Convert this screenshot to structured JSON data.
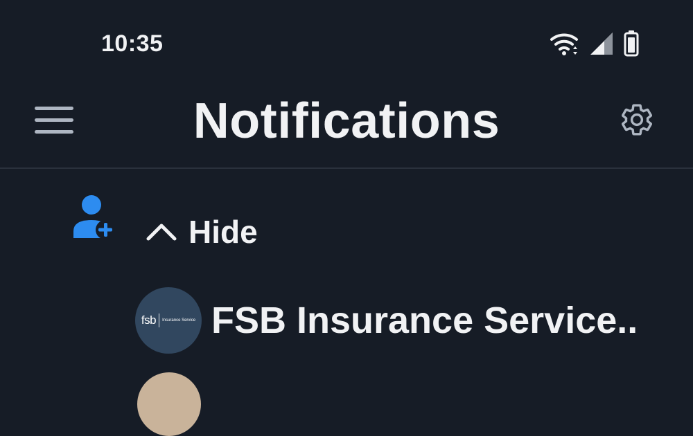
{
  "status_bar": {
    "time": "10:35",
    "icons": [
      "wifi-icon",
      "cellular-signal-icon",
      "battery-icon"
    ]
  },
  "header": {
    "title": "Notifications",
    "menu_icon": "hamburger-menu-icon",
    "settings_icon": "gear-icon"
  },
  "section": {
    "icon": "add-user-icon",
    "toggle_icon": "chevron-up-icon",
    "toggle_label": "Hide"
  },
  "notifications": [
    {
      "name": "FSB Insurance Service..",
      "avatar_logo_text": "fsb",
      "avatar_logo_subtext": "Insurance Service"
    }
  ],
  "colors": {
    "background": "#161c26",
    "text": "#f1f2f4",
    "accent": "#2d8cf0",
    "muted_icon": "#aeb6c2"
  }
}
